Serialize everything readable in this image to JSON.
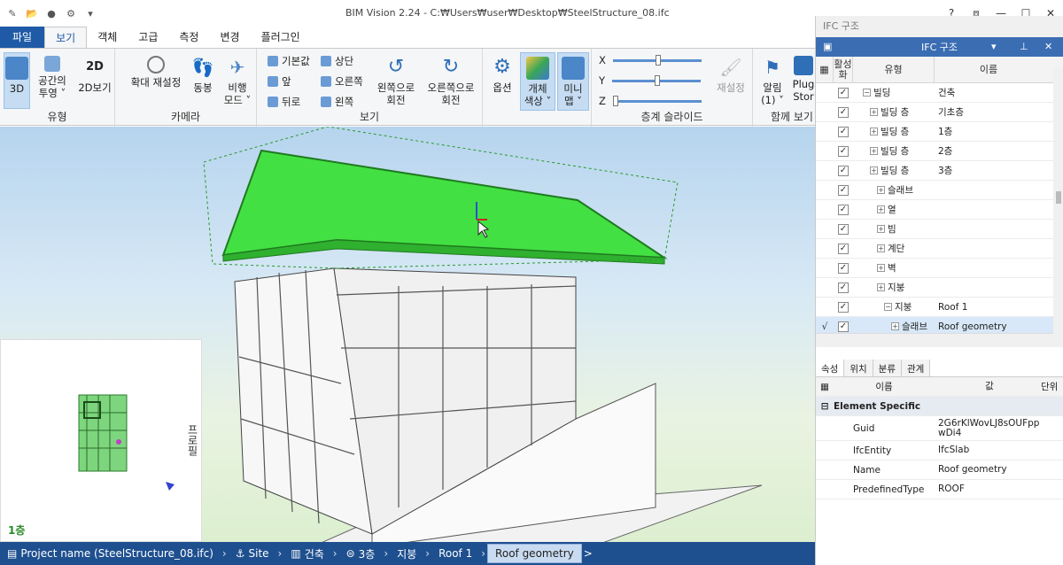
{
  "window": {
    "title": "BIM Vision 2.24 - C:₩Users₩user₩Desktop₩SteelStructure_08.ifc",
    "controls": [
      "?",
      "⧈",
      "—",
      "☐",
      "✕"
    ]
  },
  "tabs": [
    "파일",
    "보기",
    "객체",
    "고급",
    "측정",
    "변경",
    "플러그인"
  ],
  "active_tab": "보기",
  "ribbon": {
    "type_group": {
      "title": "유형",
      "btn_3d": "3D",
      "btn_proj_1": "공간의",
      "btn_proj_2": "투영 ˅",
      "btn_2d": "2D보기"
    },
    "camera_group": {
      "title": "카메라",
      "btn_reset": "확대 재설정",
      "btn_walk": "동봉",
      "btn_fly_1": "비행",
      "btn_fly_2": "모드 ˅"
    },
    "view_group": {
      "title": "보기",
      "default": "기본값",
      "top": "상단",
      "front": "앞",
      "right": "오른쪽",
      "back": "뒤로",
      "left": "왼쪽",
      "rot_left_1": "왼쪽으로",
      "rot_left_2": "회전",
      "rot_right_1": "오른쪽으로",
      "rot_right_2": "회전"
    },
    "options_group": {
      "options": "옵션",
      "objcolor_1": "개체",
      "objcolor_2": "색상 ˅",
      "minimap_1": "미니",
      "minimap_2": "맵 ˅"
    },
    "slide_group": {
      "title": "층계 슬라이드",
      "x": "X",
      "y": "Y",
      "z": "Z",
      "reset": "재설정"
    },
    "extra_group": {
      "title": "함께 보기",
      "alarm_1": "알림",
      "alarm_2": "(1) ˅",
      "plugin_1": "Plug",
      "plugin_2": "Stor"
    }
  },
  "viewport": {
    "minimap_side_label": "프로필",
    "minimap_floor": "1층"
  },
  "statusbar": {
    "project": "Project name (SteelStructure_08.ifc)",
    "site": "Site",
    "building": "건축",
    "storey": "3층",
    "roof_type": "지붕",
    "roof": "Roof 1",
    "geometry": "Roof geometry",
    "more": ">"
  },
  "panel": {
    "caption": "IFC 구조",
    "header": "IFC 구조",
    "col_active": "활성화",
    "col_type": "유형",
    "col_name": "이름",
    "tree": [
      {
        "mark": "",
        "type": "빌딩",
        "name": "건축",
        "indent": 0
      },
      {
        "mark": "",
        "type": "빌딩 층",
        "name": "기초층",
        "indent": 1
      },
      {
        "mark": "",
        "type": "빌딩 층",
        "name": "1층",
        "indent": 1
      },
      {
        "mark": "",
        "type": "빌딩 층",
        "name": "2층",
        "indent": 1
      },
      {
        "mark": "",
        "type": "빌딩 층",
        "name": "3층",
        "indent": 1
      },
      {
        "mark": "",
        "type": "슬래브",
        "name": "",
        "indent": 2
      },
      {
        "mark": "",
        "type": "열",
        "name": "",
        "indent": 2
      },
      {
        "mark": "",
        "type": "빔",
        "name": "",
        "indent": 2
      },
      {
        "mark": "",
        "type": "계단",
        "name": "",
        "indent": 2
      },
      {
        "mark": "",
        "type": "벽",
        "name": "",
        "indent": 2
      },
      {
        "mark": "",
        "type": "지붕",
        "name": "",
        "indent": 2
      },
      {
        "mark": "",
        "type": "지붕",
        "name": "Roof 1",
        "indent": 3
      },
      {
        "mark": "√",
        "type": "슬래브",
        "name": "Roof geometry",
        "indent": 4
      }
    ],
    "prop_tabs": [
      "속성",
      "위치",
      "분류",
      "관계"
    ],
    "prop_head": {
      "name": "이름",
      "value": "값",
      "unit": "단위"
    },
    "prop_category": "Element Specific",
    "props": [
      {
        "name": "Guid",
        "value": "2G6rKlWovLJ8sOUFppwDi4"
      },
      {
        "name": "IfcEntity",
        "value": "IfcSlab"
      },
      {
        "name": "Name",
        "value": "Roof geometry"
      },
      {
        "name": "PredefinedType",
        "value": "ROOF"
      }
    ]
  }
}
